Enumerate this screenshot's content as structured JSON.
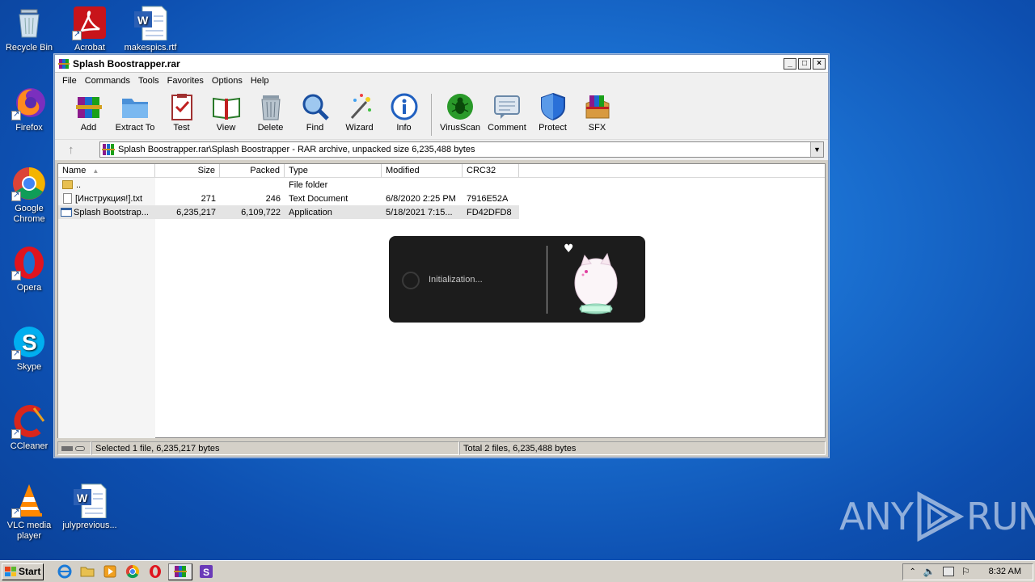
{
  "desktop": {
    "icons": [
      {
        "label": "Recycle Bin"
      },
      {
        "label": "Acrobat"
      },
      {
        "label": "makespics.rtf"
      },
      {
        "label": "Firefox"
      },
      {
        "label": "Google Chrome"
      },
      {
        "label": "Opera"
      },
      {
        "label": "Skype"
      },
      {
        "label": "CCleaner"
      },
      {
        "label": "VLC media player"
      },
      {
        "label": "julyprevious..."
      }
    ]
  },
  "window": {
    "title": "Splash Boostrapper.rar",
    "controls": {
      "minimize": "_",
      "maximize": "□",
      "close": "×"
    },
    "menu": [
      "File",
      "Commands",
      "Tools",
      "Favorites",
      "Options",
      "Help"
    ],
    "toolbar": [
      "Add",
      "Extract To",
      "Test",
      "View",
      "Delete",
      "Find",
      "Wizard",
      "Info",
      "VirusScan",
      "Comment",
      "Protect",
      "SFX"
    ],
    "address": "Splash Boostrapper.rar\\Splash Boostrapper - RAR archive, unpacked size 6,235,488 bytes",
    "columns": [
      "Name",
      "Size",
      "Packed",
      "Type",
      "Modified",
      "CRC32"
    ],
    "rows": [
      {
        "name": "..",
        "size": "",
        "packed": "",
        "type": "File folder",
        "modified": "",
        "crc": ""
      },
      {
        "name": "[Инструкция!].txt",
        "size": "271",
        "packed": "246",
        "type": "Text Document",
        "modified": "6/8/2020 2:25 PM",
        "crc": "7916E52A"
      },
      {
        "name": "Splash Bootstrap...",
        "size": "6,235,217",
        "packed": "6,109,722",
        "type": "Application",
        "modified": "5/18/2021 7:15...",
        "crc": "FD42DFD8"
      }
    ],
    "status_left": "Selected 1 file, 6,235,217 bytes",
    "status_right": "Total 2 files, 6,235,488 bytes"
  },
  "splash": {
    "text": "Initialization..."
  },
  "taskbar": {
    "start": "Start",
    "clock": "8:32 AM"
  },
  "watermark": {
    "left": "ANY",
    "right": "RUN"
  },
  "colors": {
    "desktop": "#1a6fd0",
    "window_chrome": "#f0f0f0",
    "splash_bg": "#1c1c1c"
  }
}
